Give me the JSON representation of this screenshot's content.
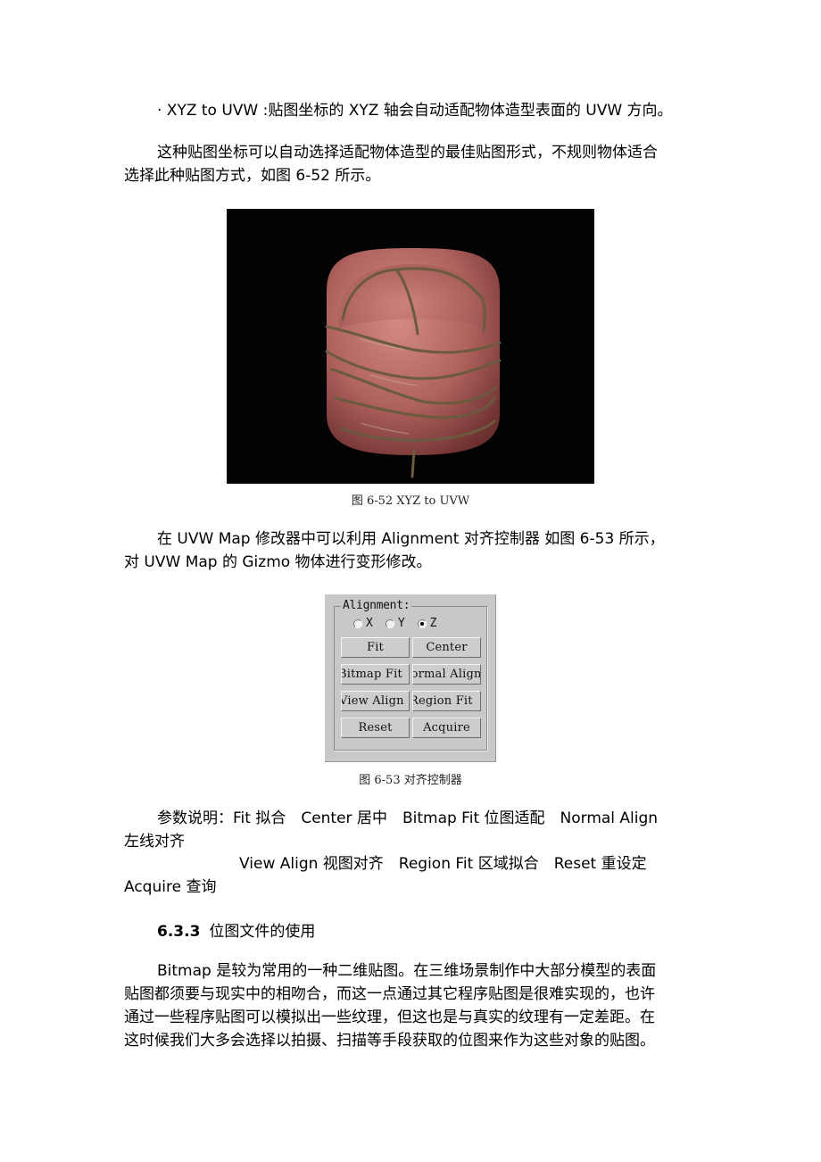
{
  "paragraphs": {
    "bullet_xyz": "· XYZ to UVW :贴图坐标的 XYZ 轴会自动适配物体造型表面的 UVW 方向。",
    "intro_line1": "这种贴图坐标可以自动选择适配物体造型的最佳贴图形式，不规则物体适合",
    "intro_line2": "选择此种贴图方式，如图 6-52 所示。",
    "alignment_line1": "在 UVW Map 修改器中可以利用 Alignment 对齐控制器 如图 6-53 所示，",
    "alignment_line2": "对 UVW Map 的 Gizmo 物体进行变形修改。",
    "params_line1": "参数说明：Fit 拟合　Center 居中　Bitmap Fit 位图适配　Normal Align",
    "params_line2": "左线对齐",
    "params_line3": "View Align 视图对齐　Region Fit 区域拟合　Reset 重设定",
    "params_line4": "Acquire 查询",
    "bitmap_line1": "Bitmap 是较为常用的一种二维贴图。在三维场景制作中大部分模型的表面",
    "bitmap_line2": "贴图都须要与现实中的相吻合，而这一点通过其它程序贴图是很难实现的，也许",
    "bitmap_line3": "通过一些程序贴图可以模拟出一些纹理，但这也是与真实的纹理有一定差距。在",
    "bitmap_line4": "这时候我们大多会选择以拍摄、扫描等手段获取的位图来作为这些对象的贴图。"
  },
  "figures": {
    "fig_6_52": {
      "caption": "图 6-52 XYZ to UVW",
      "subject": "rendered-textured-cylinder",
      "colors": {
        "background": "#030303",
        "body": "#b0625e",
        "body_highlight": "#d48a84",
        "body_shadow": "#6a2f2e",
        "band": "#6b5a3e"
      }
    },
    "fig_6_53": {
      "caption": "图 6-53  对齐控制器",
      "panel": {
        "group_label": "Alignment:",
        "radios": [
          {
            "label": "X",
            "checked": false
          },
          {
            "label": "Y",
            "checked": false
          },
          {
            "label": "Z",
            "checked": true
          }
        ],
        "buttons": [
          {
            "label": "Fit"
          },
          {
            "label": "Center"
          },
          {
            "label": "Bitmap Fit"
          },
          {
            "label": "Normal Align"
          },
          {
            "label": "View Align"
          },
          {
            "label": "Region Fit"
          },
          {
            "label": "Reset"
          },
          {
            "label": "Acquire"
          }
        ]
      }
    }
  },
  "section": {
    "number": "6.3.3",
    "title": "位图文件的使用"
  }
}
